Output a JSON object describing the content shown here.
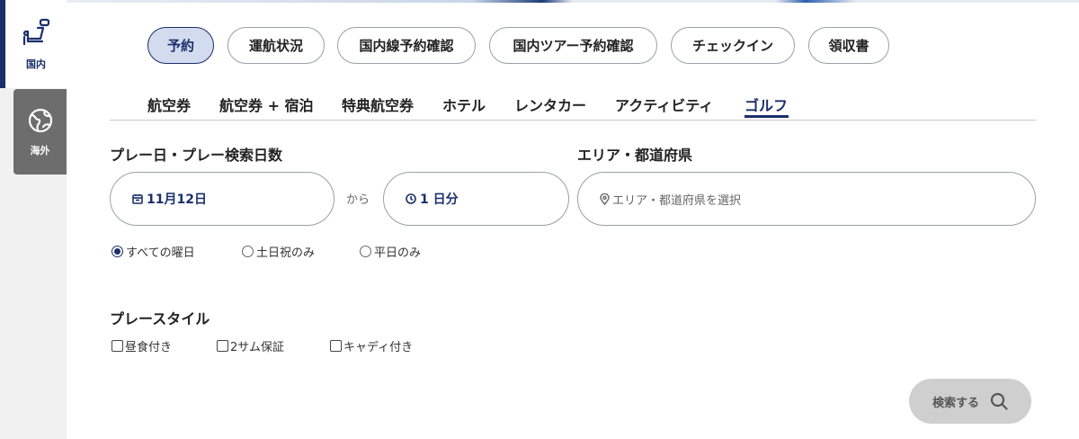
{
  "sidebar": {
    "items": [
      {
        "label": "国内",
        "icon": "airplane-seat-icon",
        "active": true
      },
      {
        "label": "海外",
        "icon": "globe-icon",
        "active": false
      }
    ]
  },
  "top_tabs": [
    {
      "label": "予約",
      "active": true
    },
    {
      "label": "運航状況",
      "active": false
    },
    {
      "label": "国内線予約確認",
      "active": false
    },
    {
      "label": "国内ツアー予約確認",
      "active": false
    },
    {
      "label": "チェックイン",
      "active": false
    },
    {
      "label": "領収書",
      "active": false
    }
  ],
  "sub_tabs": [
    {
      "label": "航空券",
      "active": false
    },
    {
      "label": "航空券 + 宿泊",
      "active": false
    },
    {
      "label": "特典航空券",
      "active": false
    },
    {
      "label": "ホテル",
      "active": false
    },
    {
      "label": "レンタカー",
      "active": false
    },
    {
      "label": "アクティビティ",
      "active": false
    },
    {
      "label": "ゴルフ",
      "active": true
    }
  ],
  "form": {
    "date_section_label": "プレー日・プレー検索日数",
    "area_section_label": "エリア・都道府県",
    "date_value": "11月12日",
    "from_label": "から",
    "days_value": "1 日分",
    "area_placeholder": "エリア・都道府県を選択",
    "day_options": [
      {
        "label": "すべての曜日",
        "selected": true
      },
      {
        "label": "土日祝のみ",
        "selected": false
      },
      {
        "label": "平日のみ",
        "selected": false
      }
    ],
    "style_section_label": "プレースタイル",
    "style_options": [
      {
        "label": "昼食付き",
        "checked": false
      },
      {
        "label": "2サム保証",
        "checked": false
      },
      {
        "label": "キャディ付き",
        "checked": false
      }
    ],
    "search_label": "検索する"
  },
  "colors": {
    "accent": "#1a2f6b",
    "active_tab_bg": "#d3dbef",
    "sidebar_inactive": "#6d6d6d",
    "search_button_bg": "#cfcfcf"
  }
}
